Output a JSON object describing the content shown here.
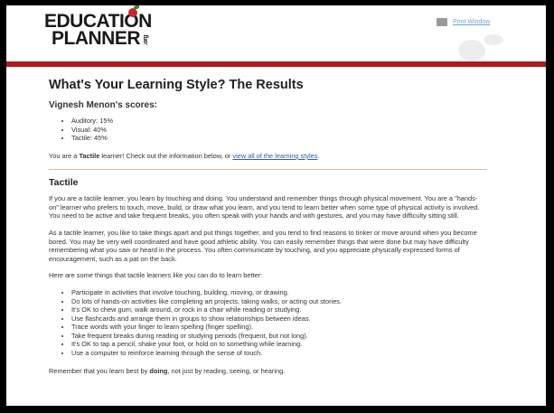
{
  "header": {
    "logo_line1": "EDUCATION",
    "logo_line2": "PLANNER",
    "logo_suffix": ".org",
    "print_label": "Print Window"
  },
  "page": {
    "title": "What's Your Learning Style? The Results",
    "scores_heading": "Vignesh Menon's scores:",
    "scores": [
      "Auditory: 15%",
      "Visual: 40%",
      "Tactile: 45%"
    ],
    "result_prefix": "You are a ",
    "result_type": "Tactile",
    "result_mid": " learner! Check out the information below, or ",
    "result_link": "view all of the learning styles",
    "result_end": "."
  },
  "tactile": {
    "heading": "Tactile",
    "para1": "If you are a tactile learner, you learn by touching and doing. You understand and remember things through physical movement. You are a \"hands-on\" learner who prefers to touch, move, build, or draw what you learn, and you tend to learn better when some type of physical activity is involved. You need to be active and take frequent breaks, you often speak with your hands and with gestures, and you may have difficulty sitting still.",
    "para2": "As a tactile learner, you like to take things apart and put things together, and you tend to find reasons to tinker or move around when you become bored. You may be very well coordinated and have good athletic ability. You can easily remember things that were done but may have difficulty remembering what you saw or heard in the process. You often communicate by touching, and you appreciate physically expressed forms of encouragement, such as a pat on the back.",
    "tips_intro": "Here are some things that tactile learners like you can do to learn better:",
    "tips": [
      "Participate in activities that involve touching, building, moving, or drawing.",
      "Do lots of hands-on activities like completing art projects, taking walks, or acting out stories.",
      "It's OK to chew gum, walk around, or rock in a chair while reading or studying.",
      "Use flashcards and arrange them in groups to show relationships between ideas.",
      "Trace words with your finger to learn spelling (finger spelling).",
      "Take frequent breaks during reading or studying periods (frequent, but not long).",
      "It's OK to tap a pencil, shake your foot, or hold on to something while learning.",
      "Use a computer to reinforce learning through the sense of touch."
    ],
    "closing_prefix": "Remember that you learn best by ",
    "closing_bold": "doing",
    "closing_end": ", not just by reading, seeing, or hearing."
  }
}
